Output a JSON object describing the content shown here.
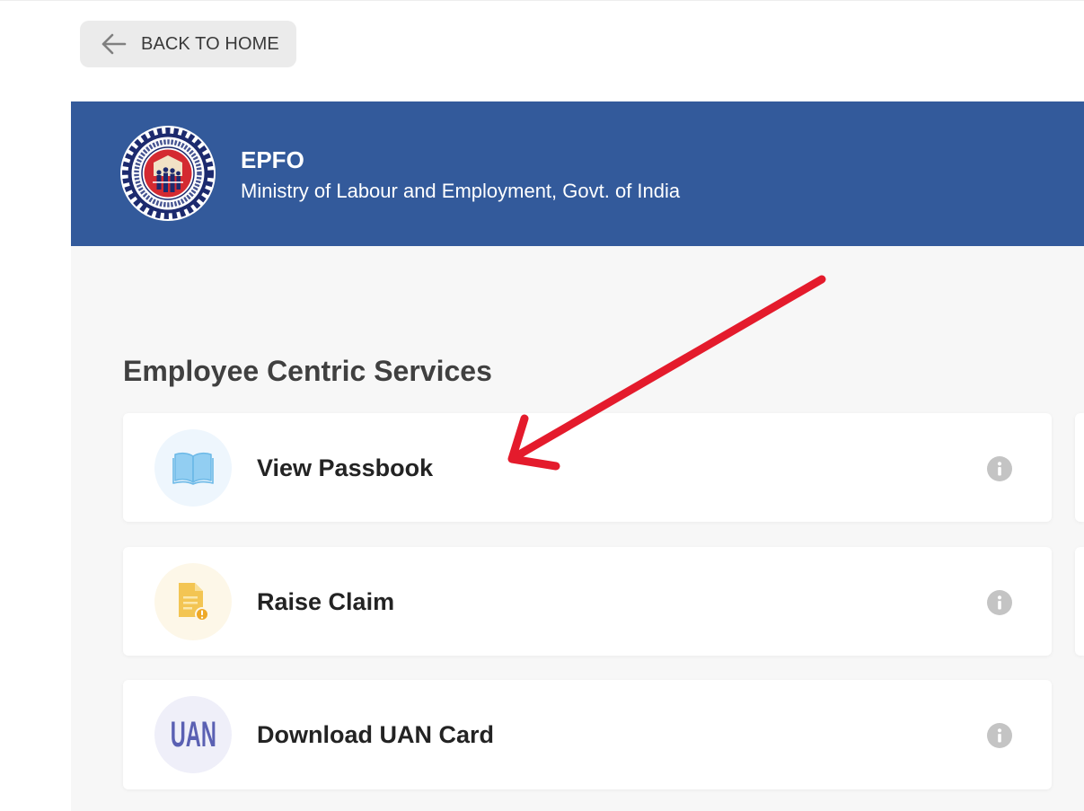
{
  "back_button": {
    "label": "BACK TO HOME",
    "icon": "arrow-left-icon"
  },
  "header": {
    "org_name": "EPFO",
    "subtitle": "Ministry of Labour and Employment, Govt. of India",
    "logo": "epfo-emblem-logo"
  },
  "section": {
    "title": "Employee Centric Services"
  },
  "services": [
    {
      "label": "View Passbook",
      "icon": "book-icon",
      "info_icon": "info-icon"
    },
    {
      "label": "Raise Claim",
      "icon": "claim-document-icon",
      "info_icon": "info-icon"
    },
    {
      "label": "Download UAN Card",
      "icon": "uan-card-icon",
      "icon_text": "UAN",
      "info_icon": "info-icon"
    }
  ],
  "colors": {
    "header_bg": "#335a9b",
    "panel_bg": "#f7f7f7",
    "back_button_bg": "#ebebeb",
    "passbook_icon_bg": "#eef6fd",
    "claim_icon_bg": "#fdf7e8",
    "uan_icon_bg": "#efeff9",
    "uan_text": "#5a60b3",
    "info_icon": "#c4c4c4",
    "annotation_red": "#e41b2c"
  }
}
